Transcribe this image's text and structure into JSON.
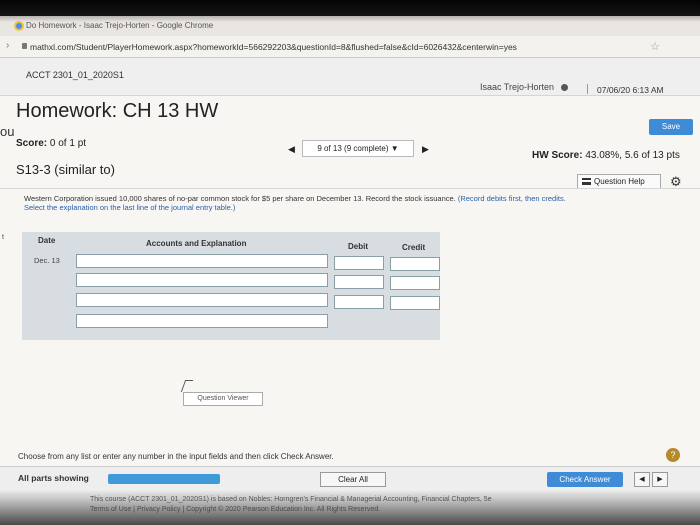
{
  "browser": {
    "window_title": "Do Homework - Isaac Trejo-Horten - Google Chrome",
    "url": "mathxl.com/Student/PlayerHomework.aspx?homeworkId=566292203&questionId=8&flushed=false&cId=6026432&centerwin=yes"
  },
  "header": {
    "course": "ACCT 2301_01_2020S1",
    "user": "Isaac Trejo-Horten",
    "datetime": "07/06/20 6:13 AM"
  },
  "homework": {
    "title": "Homework: CH 13 HW",
    "left_fragment": "ou",
    "save_label": "Save",
    "score_label": "Score:",
    "score_value": "0 of 1 pt",
    "nav_status": "9 of 13 (9 complete)",
    "hw_score_label": "HW Score:",
    "hw_score_value": "43.08%, 5.6 of 13 pts",
    "question_id": "S13-3 (similar to)",
    "help_label": "Question Help"
  },
  "question": {
    "text": "Western Corporation issued 10,000 shares of no-par common stock for $5 per share on December 13. Record the stock issuance.",
    "hint_line1": "(Record debits first, then credits.",
    "hint_line2": "Select the explanation on the last line of the journal entry table.)"
  },
  "journal": {
    "headers": {
      "date": "Date",
      "accounts": "Accounts and Explanation",
      "debit": "Debit",
      "credit": "Credit"
    },
    "date_value": "Dec. 13",
    "row_count": 4
  },
  "edge_fragment": "t",
  "question_viewer_label": "Question Viewer",
  "instruction": "Choose from any list or enter any number in the input fields and then click Check Answer.",
  "bottom": {
    "all_parts": "All parts showing",
    "clear_label": "Clear All",
    "check_label": "Check Answer"
  },
  "footer": {
    "line1": "This course (ACCT 2301_01_2020S1) is based on Nobles: Horngren's Financial & Managerial Accounting, Financial Chapters, 5e",
    "line2": "Terms of Use | Privacy Policy | Copyright © 2020 Pearson Education Inc. All Rights Reserved."
  },
  "icons": [
    "chrome-icon",
    "lock-icon",
    "star-icon",
    "person-icon",
    "chevron-left-icon",
    "chevron-right-icon",
    "list-icon",
    "gear-icon",
    "help-circle-icon",
    "cursor-icon"
  ],
  "colors": {
    "accent_blue": "#3f8bd6",
    "progress_blue": "#3f9bd8",
    "table_bg": "#d7dde0",
    "help_gold": "#b58a2a"
  }
}
